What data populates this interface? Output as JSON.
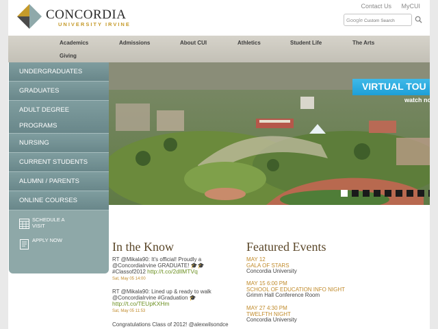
{
  "header": {
    "brand_name": "CONCORDIA",
    "brand_sub": "UNIVERSITY IRVINE",
    "top_links": [
      "Contact Us",
      "MyCUI"
    ],
    "search_placeholder": "Custom Search",
    "search_brand": "Google"
  },
  "nav": {
    "items": [
      "Academics",
      "Admissions",
      "About CUI",
      "Athletics",
      "Student Life",
      "The Arts",
      "Giving"
    ]
  },
  "sidebar": {
    "items": [
      "Undergraduates",
      "Graduates",
      "Adult Degree Programs",
      "Nursing",
      "Current Students",
      "Alumni / Parents",
      "Online Courses"
    ],
    "actions": [
      {
        "label": "Schedule a Visit",
        "icon": "calendar-icon"
      },
      {
        "label": "Apply Now",
        "icon": "document-icon"
      }
    ]
  },
  "hero": {
    "banner": "VIRTUAL TOU",
    "banner_sub": "watch now",
    "slide_count": 10,
    "active_slide": 1
  },
  "in_the_know": {
    "title": "In the Know",
    "tweets": [
      {
        "text": "RT @Mikala90: It's official! Proudly a @ConcordiaIrvine GRADUATE! 🎓🎓 #Classof2012",
        "link": "http://t.co/2dIlMTVq",
        "date": "Sat, May 05 14:00"
      },
      {
        "text": "RT @Mikala90: Lined up & ready to walk @ConcordiaIrvine #Graduation 🎓",
        "link": "http://t.co/TEUpKXHm",
        "date": "Sat, May 05 11:53"
      },
      {
        "text": "Congratulations Class of 2012! @alexwilsondce",
        "link": "",
        "date": ""
      }
    ]
  },
  "featured_events": {
    "title": "Featured Events",
    "events": [
      {
        "date": "MAY 12",
        "title": "GALA OF STARS",
        "location": "Concordia University"
      },
      {
        "date": "MAY 15 6:00 PM",
        "title": "SCHOOL OF EDUCATION INFO NIGHT",
        "location": "Grimm Hall Conference Room"
      },
      {
        "date": "MAY 27 4:30 PM",
        "title": "TWELFTH NIGHT",
        "location": "Concordia University"
      }
    ]
  },
  "colors": {
    "gold": "#c59a2a",
    "sidebar_teal": "#6f8c8e",
    "nav_tan": "#ccc9bf",
    "banner_blue": "#2aa8df",
    "heading_brown": "#5a4628"
  }
}
